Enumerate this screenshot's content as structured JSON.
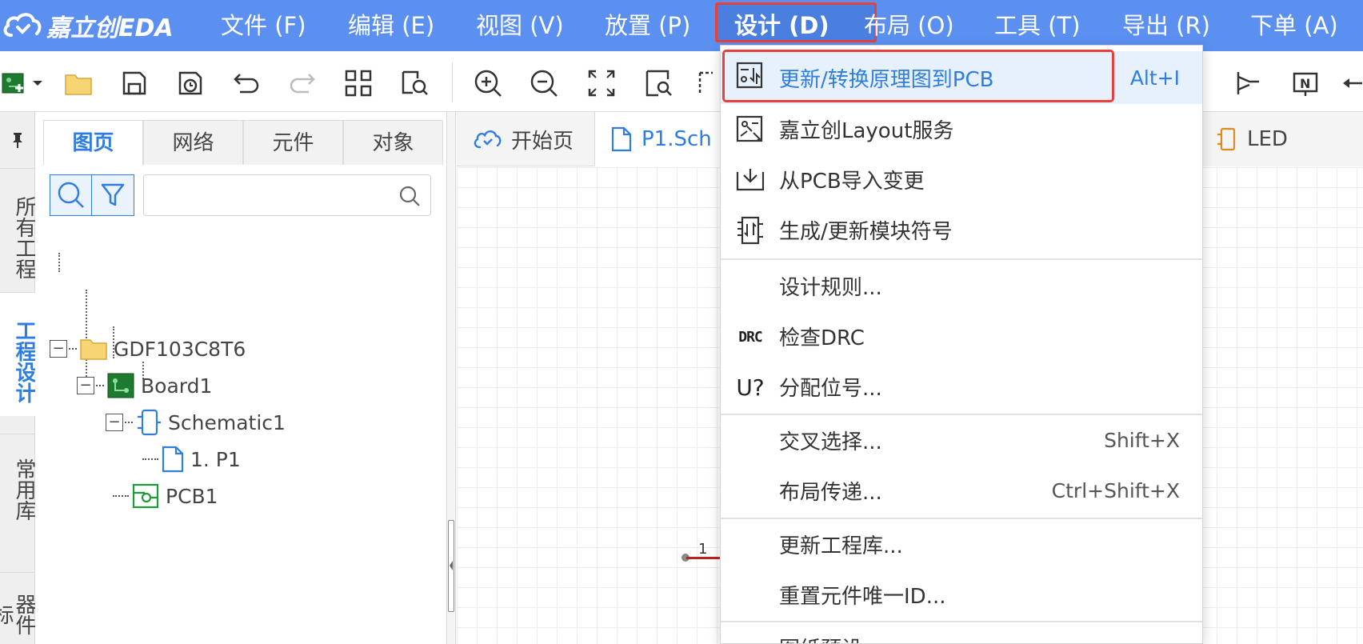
{
  "app": {
    "logo_text": "嘉立创EDA"
  },
  "menubar": {
    "items": [
      {
        "label": "文件 (F)"
      },
      {
        "label": "编辑 (E)"
      },
      {
        "label": "视图 (V)"
      },
      {
        "label": "放置 (P)"
      },
      {
        "label": "设计 (D)",
        "active": true
      },
      {
        "label": "布局 (O)"
      },
      {
        "label": "工具 (T)"
      },
      {
        "label": "导出 (R)"
      },
      {
        "label": "下单 (A)"
      }
    ]
  },
  "rail": {
    "tabs": [
      {
        "label": "所有工程"
      },
      {
        "label": "工程设计",
        "active": true
      },
      {
        "label": "常用库"
      },
      {
        "label": "器件标"
      }
    ]
  },
  "panel": {
    "tabs": [
      {
        "label": "图页",
        "active": true
      },
      {
        "label": "网络"
      },
      {
        "label": "元件"
      },
      {
        "label": "对象"
      }
    ],
    "search": {
      "value": "",
      "placeholder": ""
    },
    "tree": [
      {
        "label": "GDF103C8T6",
        "icon": "folder-icon"
      },
      {
        "label": "Board1",
        "icon": "board-icon"
      },
      {
        "label": "Schematic1",
        "icon": "schematic-icon"
      },
      {
        "label": "1. P1",
        "icon": "page-icon"
      },
      {
        "label": "PCB1",
        "icon": "pcb-icon"
      }
    ]
  },
  "doctabs": [
    {
      "label": "开始页",
      "icon": "cloud-icon"
    },
    {
      "label": "P1.Sch",
      "icon": "page-icon",
      "active": true
    },
    {
      "label": "LED",
      "icon": "symbol-icon"
    }
  ],
  "canvas": {
    "pin_number": "1"
  },
  "design_menu": {
    "items": [
      {
        "label": "更新/转换原理图到PCB",
        "shortcut": "Alt+I",
        "icon": "update-pcb-icon",
        "highlighted": true
      },
      {
        "label": "嘉立创Layout服务",
        "shortcut": "",
        "icon": "layout-service-icon"
      },
      {
        "label": "从PCB导入变更",
        "shortcut": "",
        "icon": "import-changes-icon"
      },
      {
        "label": "生成/更新模块符号",
        "shortcut": "",
        "icon": "module-symbol-icon"
      },
      {
        "label": "设计规则...",
        "shortcut": "",
        "icon": ""
      },
      {
        "label": "检查DRC",
        "shortcut": "",
        "icon": "drc-icon",
        "icon_text": "DRC"
      },
      {
        "label": "分配位号...",
        "shortcut": "",
        "icon": "designator-icon",
        "icon_text": "U?"
      },
      {
        "label": "交叉选择...",
        "shortcut": "Shift+X",
        "icon": ""
      },
      {
        "label": "布局传递...",
        "shortcut": "Ctrl+Shift+X",
        "icon": ""
      },
      {
        "label": "更新工程库...",
        "shortcut": "",
        "icon": ""
      },
      {
        "label": "重置元件唯一ID...",
        "shortcut": "",
        "icon": ""
      },
      {
        "label": "图纸预设...",
        "shortcut": "",
        "icon": ""
      }
    ]
  },
  "colors": {
    "menubar": "#5b8ff0",
    "accent": "#2f7de1",
    "highlight_box": "#e8413a"
  }
}
